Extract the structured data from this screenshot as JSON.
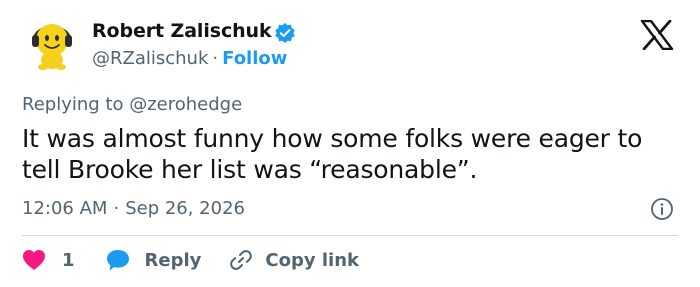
{
  "author": {
    "name": "Robert Zalischuk",
    "handle": "@RZalischuk",
    "separator": "·",
    "follow_label": "Follow"
  },
  "reply_context": {
    "prefix": "Replying to",
    "mention": "@zerohedge"
  },
  "tweet": {
    "text": "It was almost funny how some folks were eager to tell Brooke her list was “reasonable”."
  },
  "meta": {
    "time": "12:06 AM",
    "separator": "·",
    "date": "Sep 26, 2026"
  },
  "actions": {
    "like_count": "1",
    "reply_label": "Reply",
    "copy_link_label": "Copy link"
  },
  "icons": {
    "avatar": "yellow-smiley-headphones-avatar",
    "verified": "verified-badge-icon",
    "brand": "x-logo-icon",
    "info": "info-icon",
    "like": "heart-icon",
    "reply": "speech-bubble-icon",
    "copy": "link-icon"
  },
  "colors": {
    "text_primary": "#0f1419",
    "text_secondary": "#536471",
    "accent": "#1d9bf0",
    "like": "#f91880",
    "divider": "#cfd9de",
    "avatar_yellow": "#f7d21a"
  }
}
